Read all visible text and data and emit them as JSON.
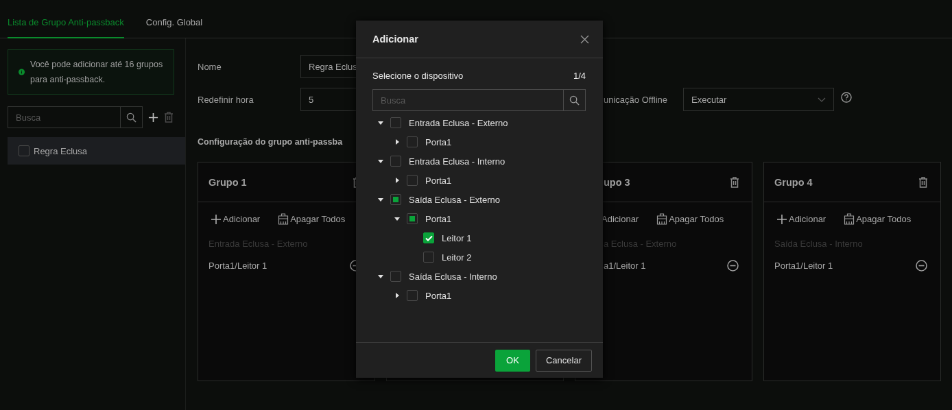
{
  "tabs": [
    {
      "label": "Lista de Grupo Anti-passback",
      "selected": true
    },
    {
      "label": "Config. Global",
      "selected": false
    }
  ],
  "sidebar": {
    "info": "Você pode adicionar até 16 grupos para anti-passback.",
    "search": {
      "placeholder": "Busca"
    },
    "items": [
      {
        "label": "Regra Eclusa",
        "checked": false,
        "selected": true
      }
    ]
  },
  "form": {
    "name_label": "Nome",
    "name_value": "Regra Eclus",
    "reset_label": "Redefinir hora",
    "reset_value": "5",
    "offline_label": "unicação Offline",
    "offline_value": "Executar"
  },
  "section_title": "Configuração do grupo anti-passba",
  "groups": [
    {
      "kind": "full",
      "title": "Grupo 1",
      "add": "Adicionar",
      "clear": "Apagar Todos",
      "subtitle": "Entrada Eclusa - Externo",
      "item": "Porta1/Leitor 1"
    },
    {
      "kind": "hidden"
    },
    {
      "kind": "partial",
      "title": "upo 3",
      "add": "Adicionar",
      "clear": "Apagar Todos",
      "subtitle": "a Eclusa - Externo",
      "item": "a1/Leitor 1"
    },
    {
      "kind": "full",
      "title": "Grupo 4",
      "add": "Adicionar",
      "clear": "Apagar Todos",
      "subtitle": "Saída Eclusa - Interno",
      "item": "Porta1/Leitor 1"
    }
  ],
  "dialog": {
    "title": "Adicionar",
    "subtitle": "Selecione o dispositivo",
    "count": "1/4",
    "search": {
      "placeholder": "Busca"
    },
    "tree": [
      {
        "kind": "group",
        "label": "Entrada Eclusa - Externo",
        "expanded": true,
        "checked": false,
        "partial": false,
        "children": [
          {
            "kind": "group",
            "label": "Porta1",
            "expanded": false,
            "checked": false,
            "partial": false
          }
        ]
      },
      {
        "kind": "group",
        "label": "Entrada Eclusa - Interno",
        "expanded": true,
        "checked": false,
        "partial": false,
        "children": [
          {
            "kind": "group",
            "label": "Porta1",
            "expanded": false,
            "checked": false,
            "partial": false
          }
        ]
      },
      {
        "kind": "group",
        "label": "Saída Eclusa - Externo",
        "expanded": true,
        "checked": false,
        "partial": true,
        "children": [
          {
            "kind": "group",
            "label": "Porta1",
            "expanded": true,
            "checked": false,
            "partial": true,
            "children": [
              {
                "kind": "leaf",
                "label": "Leitor 1",
                "checked": true
              },
              {
                "kind": "leaf",
                "label": "Leitor 2",
                "checked": false
              }
            ]
          }
        ]
      },
      {
        "kind": "group",
        "label": "Saída Eclusa - Interno",
        "expanded": true,
        "checked": false,
        "partial": false,
        "children": [
          {
            "kind": "group",
            "label": "Porta1",
            "expanded": false,
            "checked": false,
            "partial": false
          }
        ]
      }
    ],
    "ok": "OK",
    "cancel": "Cancelar"
  }
}
